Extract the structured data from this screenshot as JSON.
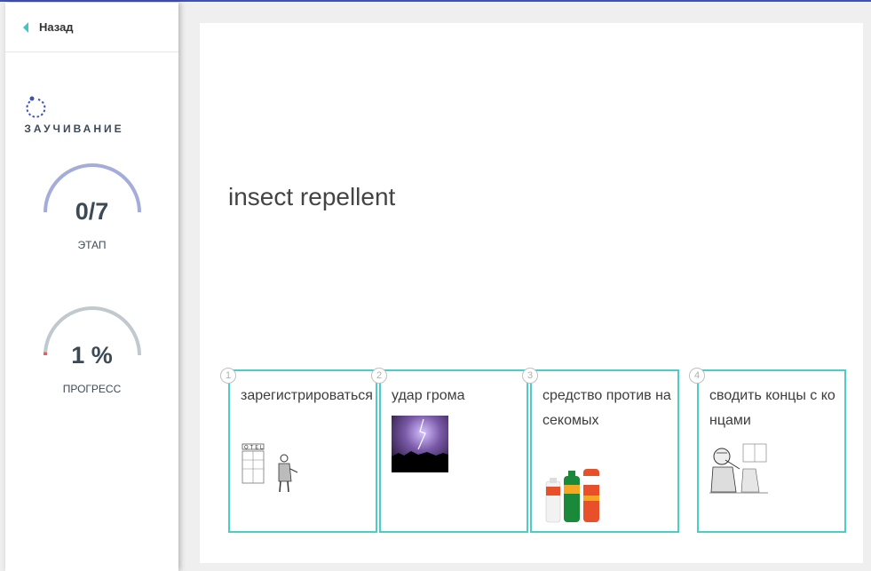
{
  "back": {
    "label": "Назад"
  },
  "mode": {
    "label": "ЗАУЧИВАНИЕ"
  },
  "stage": {
    "value": "0/7",
    "label": "ЭТАП",
    "fraction": 0.0
  },
  "progress": {
    "value": "1 %",
    "label": "ПРОГРЕСС",
    "percent": 1
  },
  "question": {
    "term": "insect repellent"
  },
  "options": [
    {
      "number": "1",
      "text": "зарегистрироваться",
      "image": "hotel-checkin-sketch"
    },
    {
      "number": "2",
      "text": "удар грома",
      "image": "lightning-night-photo"
    },
    {
      "number": "3",
      "text": "средство против насекомых",
      "image": "off-spray-cans"
    },
    {
      "number": "4",
      "text": "сводить концы с концами",
      "image": "worried-man-sketch"
    }
  ],
  "colors": {
    "accent": "#3cc8c8",
    "stage_arc": "#a4acd9",
    "progress_arc": "#c0c9ce",
    "progress_fill": "#f05a4f",
    "topline": "#3f51b5"
  }
}
